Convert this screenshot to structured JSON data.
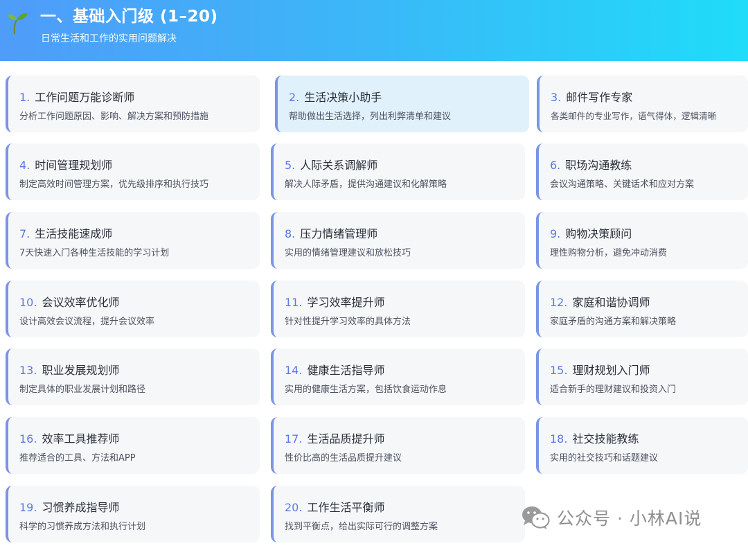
{
  "header": {
    "title": "一、基础入门级 (1–20)",
    "subtitle": "日常生活和工作的实用问题解决"
  },
  "cards": [
    {
      "num": "1.",
      "title": "工作问题万能诊断师",
      "desc": "分析工作问题原因、影响、解决方案和预防措施"
    },
    {
      "num": "2.",
      "title": "生活决策小助手",
      "desc": "帮助做出生活选择，列出利弊清单和建议"
    },
    {
      "num": "3.",
      "title": "邮件写作专家",
      "desc": "各类邮件的专业写作，语气得体，逻辑清晰"
    },
    {
      "num": "4.",
      "title": "时间管理规划师",
      "desc": "制定高效时间管理方案，优先级排序和执行技巧"
    },
    {
      "num": "5.",
      "title": "人际关系调解师",
      "desc": "解决人际矛盾，提供沟通建议和化解策略"
    },
    {
      "num": "6.",
      "title": "职场沟通教练",
      "desc": "会议沟通策略、关键话术和应对方案"
    },
    {
      "num": "7.",
      "title": "生活技能速成师",
      "desc": "7天快速入门各种生活技能的学习计划"
    },
    {
      "num": "8.",
      "title": "压力情绪管理师",
      "desc": "实用的情绪管理建议和放松技巧"
    },
    {
      "num": "9.",
      "title": "购物决策顾问",
      "desc": "理性购物分析，避免冲动消费"
    },
    {
      "num": "10.",
      "title": "会议效率优化师",
      "desc": "设计高效会议流程，提升会议效率"
    },
    {
      "num": "11.",
      "title": "学习效率提升师",
      "desc": "针对性提升学习效率的具体方法"
    },
    {
      "num": "12.",
      "title": "家庭和谐协调师",
      "desc": "家庭矛盾的沟通方案和解决策略"
    },
    {
      "num": "13.",
      "title": "职业发展规划师",
      "desc": "制定具体的职业发展计划和路径"
    },
    {
      "num": "14.",
      "title": "健康生活指导师",
      "desc": "实用的健康生活方案，包括饮食运动作息"
    },
    {
      "num": "15.",
      "title": "理财规划入门师",
      "desc": "适合新手的理财建议和投资入门"
    },
    {
      "num": "16.",
      "title": "效率工具推荐师",
      "desc": "推荐适合的工具、方法和APP"
    },
    {
      "num": "17.",
      "title": "生活品质提升师",
      "desc": "性价比高的生活品质提升建议"
    },
    {
      "num": "18.",
      "title": "社交技能教练",
      "desc": "实用的社交技巧和话题建议"
    },
    {
      "num": "19.",
      "title": "习惯养成指导师",
      "desc": "科学的习惯养成方法和执行计划"
    },
    {
      "num": "20.",
      "title": "工作生活平衡师",
      "desc": "找到平衡点，给出实际可行的调整方案"
    }
  ],
  "watermark": {
    "text": "公众号 · 小林AI说",
    "icon": "wechat-icon"
  },
  "colors": {
    "accent": "#7b94e6",
    "number": "#5a79e0",
    "card_bg": "#f6f7f9",
    "card_highlight_bg": "#e1f1fc",
    "header_gradient_start": "#4f9cf9",
    "header_gradient_end": "#1fdcf9"
  }
}
